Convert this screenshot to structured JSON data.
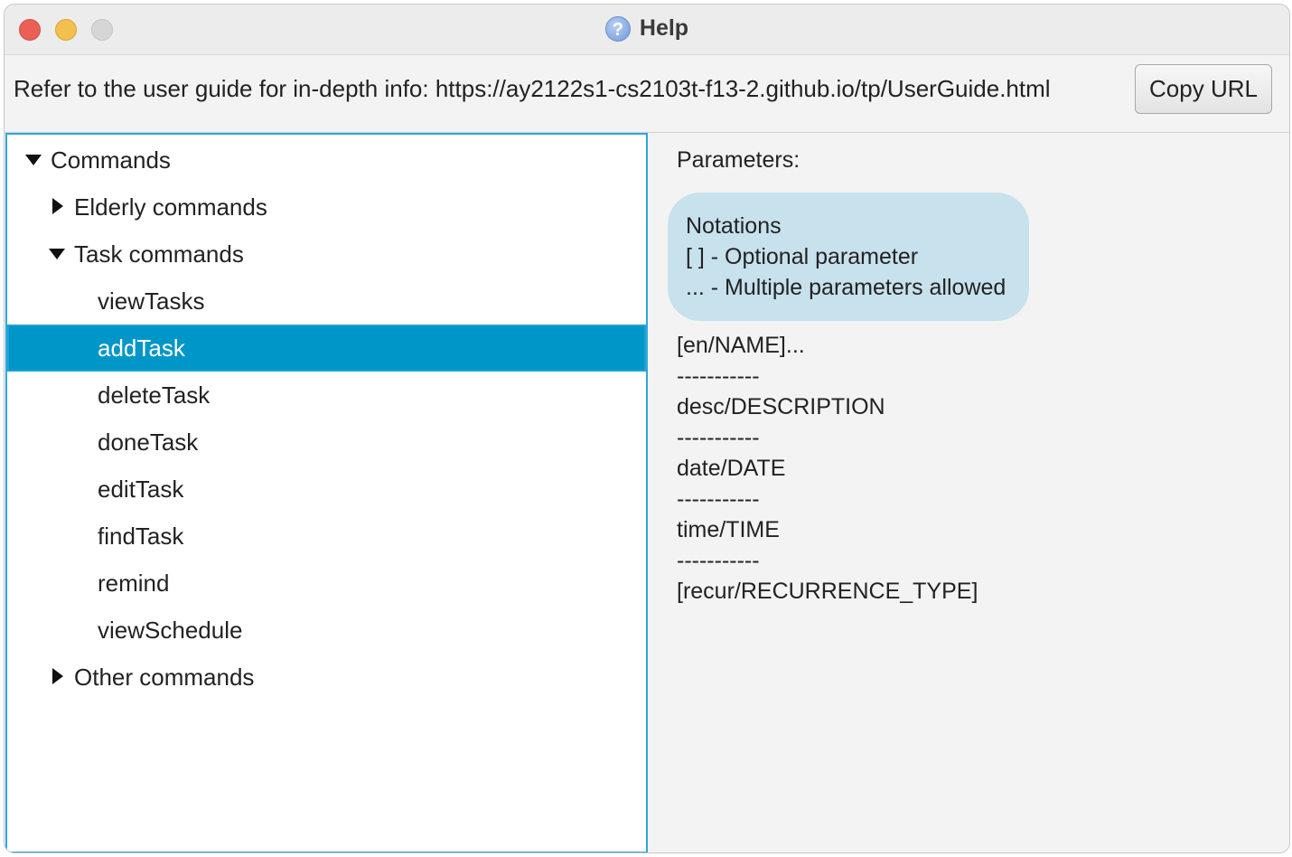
{
  "window": {
    "title": "Help",
    "title_icon": "question-icon",
    "controls": [
      "close",
      "minimize",
      "maximize"
    ]
  },
  "topbar": {
    "guide_text": "Refer to the user guide for in-depth info: https://ay2122s1-cs2103t-f13-2.github.io/tp/UserGuide.html",
    "copy_label": "Copy URL"
  },
  "tree": {
    "root_label": "Commands",
    "elderly_label": "Elderly commands",
    "task_label": "Task commands",
    "task_items": [
      "viewTasks",
      "addTask",
      "deleteTask",
      "doneTask",
      "editTask",
      "findTask",
      "remind",
      "viewSchedule"
    ],
    "other_label": "Other commands",
    "selected": "addTask"
  },
  "details": {
    "heading": "Parameters:",
    "notations": [
      "Notations",
      "[ ] - Optional parameter",
      "... - Multiple parameters allowed"
    ],
    "params": [
      "[en/NAME]...",
      "-----------",
      "desc/DESCRIPTION",
      "-----------",
      "date/DATE",
      "-----------",
      "time/TIME",
      "-----------",
      "[recur/RECURRENCE_TYPE]"
    ]
  },
  "colors": {
    "selection": "#0096c8",
    "focus_border": "#2ea8d8",
    "notation_bg": "#c7e1ed"
  }
}
